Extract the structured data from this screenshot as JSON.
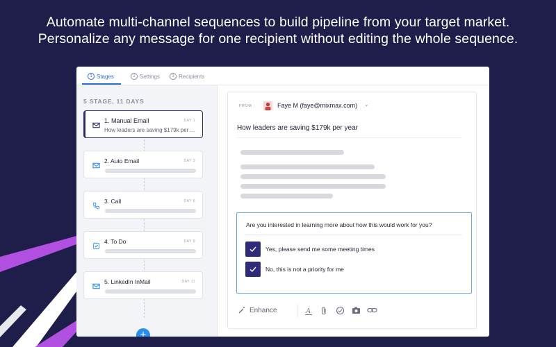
{
  "headline": {
    "line1": "Automate multi-channel sequences to build pipeline from your target market.",
    "line2": "Personalize any message for one recipient without editing the whole sequence."
  },
  "colors": {
    "background": "#1f1d4a",
    "accent": "#2b6ed2",
    "active_stage": "#2e2c66",
    "checkbox": "#2e2c7a",
    "add_button": "#2c8df0",
    "decor_stripe": "#b14fe0"
  },
  "tabs": [
    {
      "num": "1",
      "label": "Stages",
      "active": true
    },
    {
      "num": "2",
      "label": "Settings",
      "active": false
    },
    {
      "num": "3",
      "label": "Recipients",
      "active": false
    }
  ],
  "stage_summary": "5 STAGE, 11 DAYS",
  "stages": [
    {
      "title": "1. Manual Email",
      "day": "DAY 1",
      "subtitle": "How leaders are saving $179k per ...",
      "icon": "mail-icon"
    },
    {
      "title": "2. Auto Email",
      "day": "DAY 3",
      "icon": "mail-icon"
    },
    {
      "title": "3. Call",
      "day": "DAY 6",
      "icon": "phone-icon"
    },
    {
      "title": "4. To Do",
      "day": "DAY 9",
      "icon": "todo-check-icon"
    },
    {
      "title": "5. LinkedIn InMail",
      "day": "DAY 11",
      "icon": "mail-icon"
    }
  ],
  "add_stage_label": "+",
  "email": {
    "from_label": "FROM :",
    "from_name": "Faye M (faye@mixmax.com)",
    "subject": "How leaders are saving $179k per year"
  },
  "poll": {
    "question": "Are you interested in learning more about how this would work for you?",
    "options": [
      "Yes, please send me some meeting times",
      "No, this is not a priority for me"
    ]
  },
  "toolbar": {
    "enhance_label": "Enhance"
  }
}
